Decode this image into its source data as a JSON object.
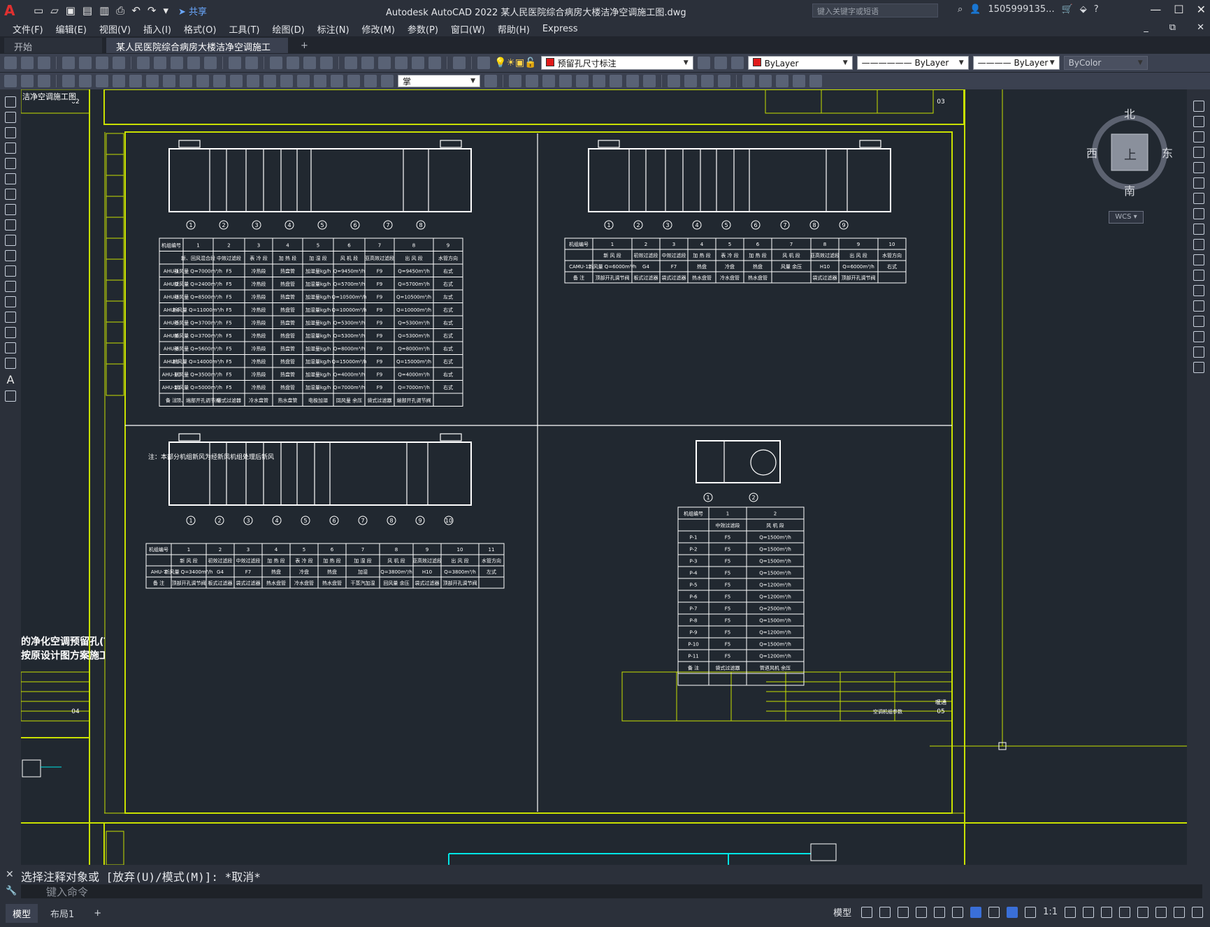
{
  "app": {
    "title": "Autodesk AutoCAD 2022    某人民医院综合病房大楼洁净空调施工图.dwg",
    "share": "共享",
    "search_placeholder": "键入关键字或短语",
    "user": "1505999135...",
    "logo": "A"
  },
  "menu": [
    "文件(F)",
    "编辑(E)",
    "视图(V)",
    "插入(I)",
    "格式(O)",
    "工具(T)",
    "绘图(D)",
    "标注(N)",
    "修改(M)",
    "参数(P)",
    "窗口(W)",
    "帮助(H)",
    "Express"
  ],
  "tabs": {
    "start": "开始",
    "doc": "某人民医院综合病房大楼洁净空调施工图*",
    "plus": "+"
  },
  "toolbar": {
    "layer": "预留孔尺寸标注",
    "color": "ByLayer",
    "linetype": "ByLayer",
    "lineweight": "ByLayer",
    "plotstyle": "ByColor",
    "textstyle": "掌"
  },
  "viewcube": {
    "north": "北",
    "south": "南",
    "east": "东",
    "west": "西",
    "top": "上",
    "wcs": "WCS"
  },
  "drawing": {
    "unit_tables": {
      "ahu": {
        "header_nums": [
          "1",
          "2",
          "3",
          "4",
          "5",
          "6",
          "7",
          "8",
          "9"
        ],
        "headers": [
          "新、回风混合段",
          "中效过滤段",
          "表 冷 段",
          "加 热 段",
          "加 湿 段",
          "风 机 段",
          "亚高效过滤段",
          "出 风 段",
          "水管方向"
        ],
        "row_label": "机组编号",
        "rows": [
          [
            "AHU-1",
            "新风量 Q=7000m³/h",
            "F5",
            "冷热段",
            "热盘管",
            "加湿量kg/h",
            "Q=9450m³/h",
            "F9",
            "Q=9450m³/h",
            "右式"
          ],
          [
            "AHU-2",
            "新风量 Q=2400m³/h",
            "F5",
            "冷热段",
            "热盘管",
            "加湿量kg/h",
            "Q=5700m³/h",
            "F9",
            "Q=5700m³/h",
            "右式"
          ],
          [
            "AHU-3",
            "新风量 Q=8500m³/h",
            "F5",
            "冷热段",
            "热盘管",
            "加湿量kg/h",
            "Q=10500m³/h",
            "F9",
            "Q=10500m³/h",
            "左式"
          ],
          [
            "AHU-4",
            "新风量 Q=11000m³/h",
            "F5",
            "冷热段",
            "热盘管",
            "加湿量kg/h",
            "Q=10000m³/h",
            "F9",
            "Q=10000m³/h",
            "右式"
          ],
          [
            "AHU-5",
            "新风量 Q=3700m³/h",
            "F5",
            "冷热段",
            "热盘管",
            "加湿量kg/h",
            "Q=5300m³/h",
            "F9",
            "Q=5300m³/h",
            "右式"
          ],
          [
            "AHU-6",
            "新风量 Q=3700m³/h",
            "F5",
            "冷热段",
            "热盘管",
            "加湿量kg/h",
            "Q=5300m³/h",
            "F9",
            "Q=5300m³/h",
            "右式"
          ],
          [
            "AHU-8",
            "新风量 Q=5600m³/h",
            "F5",
            "冷热段",
            "热盘管",
            "加湿量kg/h",
            "Q=8000m³/h",
            "F9",
            "Q=8000m³/h",
            "右式"
          ],
          [
            "AHU-9",
            "新风量 Q=14000m³/h",
            "F5",
            "冷热段",
            "热盘管",
            "加湿量kg/h",
            "Q=15000m³/h",
            "F9",
            "Q=15000m³/h",
            "右式"
          ],
          [
            "AHU-10",
            "新风量 Q=3500m³/h",
            "F5",
            "冷热段",
            "热盘管",
            "加湿量kg/h",
            "Q=4000m³/h",
            "F9",
            "Q=4000m³/h",
            "右式"
          ],
          [
            "AHU-11",
            "新风量 Q=5000m³/h",
            "F5",
            "冷热段",
            "热盘管",
            "加湿量kg/h",
            "Q=7000m³/h",
            "F9",
            "Q=7000m³/h",
            "右式"
          ]
        ],
        "remark_label": "备 注",
        "remark": [
          "顶、端部开孔调节阀",
          "袋式过滤器",
          "冷水盘管",
          "热水盘管",
          "电极加湿",
          "回风量 余压",
          "袋式过滤器",
          "端部开孔调节阀"
        ]
      },
      "note": "注：本部分机组新风为经新风机组处理后新风",
      "camu": {
        "header_nums": [
          "1",
          "2",
          "3",
          "4",
          "5",
          "6",
          "7",
          "8",
          "9",
          "10"
        ],
        "headers": [
          "新 风 段",
          "初效过滤段",
          "中效过滤段",
          "加 热 段",
          "表 冷 段",
          "加 热 段",
          "风 机 段",
          "亚高效过滤段",
          "出 风 段",
          "水管方向"
        ],
        "row": [
          "CAMU-1",
          "新风量 Q=6000m³/h",
          "G4",
          "F7",
          "热盘",
          "冷盘",
          "热盘",
          "风量 余压",
          "H10",
          "Q=6000m³/h",
          "右式"
        ],
        "remark": [
          "顶部开孔调节阀",
          "板式过滤器",
          "袋式过滤器",
          "热水盘管",
          "冷水盘管",
          "热水盘管",
          "",
          "袋式过滤器",
          "顶部开孔调节阀"
        ]
      },
      "ahu7": {
        "header_nums": [
          "1",
          "2",
          "3",
          "4",
          "5",
          "6",
          "7",
          "8",
          "9",
          "10",
          "11"
        ],
        "headers": [
          "新 风 段",
          "初效过滤段",
          "中效过滤段",
          "加 热 段",
          "表 冷 段",
          "加 热 段",
          "加 湿 段",
          "风 机 段",
          "亚高效过滤段",
          "出 风 段",
          "水管方向"
        ],
        "row": [
          "AHU-7",
          "新风量 Q=3400m³/h",
          "G4",
          "F7",
          "热盘",
          "冷盘",
          "热盘",
          "加湿",
          "Q=3800m³/h",
          "H10",
          "Q=3800m³/h",
          "左式"
        ],
        "remark": [
          "顶部开孔调节阀",
          "板式过滤器",
          "袋式过滤器",
          "热水盘管",
          "冷水盘管",
          "热水盘管",
          "干蒸汽加湿",
          "回风量 余压",
          "袋式过滤器",
          "顶部开孔调节阀"
        ]
      },
      "fan": {
        "header_nums": [
          "1",
          "2"
        ],
        "headers": [
          "中效过滤段",
          "风 机 段"
        ],
        "rows": [
          [
            "P-1",
            "F5",
            "Q=1500m³/h"
          ],
          [
            "P-2",
            "F5",
            "Q=1500m³/h"
          ],
          [
            "P-3",
            "F5",
            "Q=1500m³/h"
          ],
          [
            "P-4",
            "F5",
            "Q=1500m³/h"
          ],
          [
            "P-5",
            "F5",
            "Q=1200m³/h"
          ],
          [
            "P-6",
            "F5",
            "Q=1200m³/h"
          ],
          [
            "P-7",
            "F5",
            "Q=2500m³/h"
          ],
          [
            "P-8",
            "F5",
            "Q=1500m³/h"
          ],
          [
            "P-9",
            "F5",
            "Q=1200m³/h"
          ],
          [
            "P-10",
            "F5",
            "Q=1500m³/h"
          ],
          [
            "P-11",
            "F5",
            "Q=1200m³/h"
          ]
        ],
        "remark": [
          "袋式过滤器",
          "管道风机 余压"
        ]
      }
    },
    "callouts_top_left": [
      "1",
      "2",
      "3",
      "4",
      "5",
      "6",
      "7",
      "8"
    ],
    "callouts_top_right": [
      "1",
      "2",
      "3",
      "4",
      "5",
      "6",
      "7",
      "8",
      "9"
    ],
    "callouts_bottom_left": [
      "1",
      "2",
      "3",
      "4",
      "5",
      "6",
      "7",
      "8",
      "9",
      "10"
    ],
    "callouts_fan": [
      "1",
      "2"
    ],
    "left_title": [
      "的净化空调预留孔(T)图",
      "按原设计图方案施工"
    ],
    "title_block": {
      "sheet_top": "03",
      "sheet_top_left": "02",
      "sheet_bottom_left": "04",
      "sheet_bottom_right": "05",
      "label_type": "暖通",
      "label_name": "空调机组参数"
    },
    "overlay_text": "洁净空调施工图"
  },
  "command": {
    "history": "选择注释对象或 [放弃(U)/模式(M)]: *取消*",
    "placeholder": "键入命令"
  },
  "status": {
    "model_tab": "模型",
    "layout_tab": "布局1",
    "plus": "+",
    "model_label": "模型",
    "scale": "1:1"
  },
  "colors": {
    "frame": "#c8e000",
    "lines": "#ffffff",
    "cyan": "#00e5e5",
    "bg": "#212830",
    "layer_swatch": "#e01b1b"
  }
}
